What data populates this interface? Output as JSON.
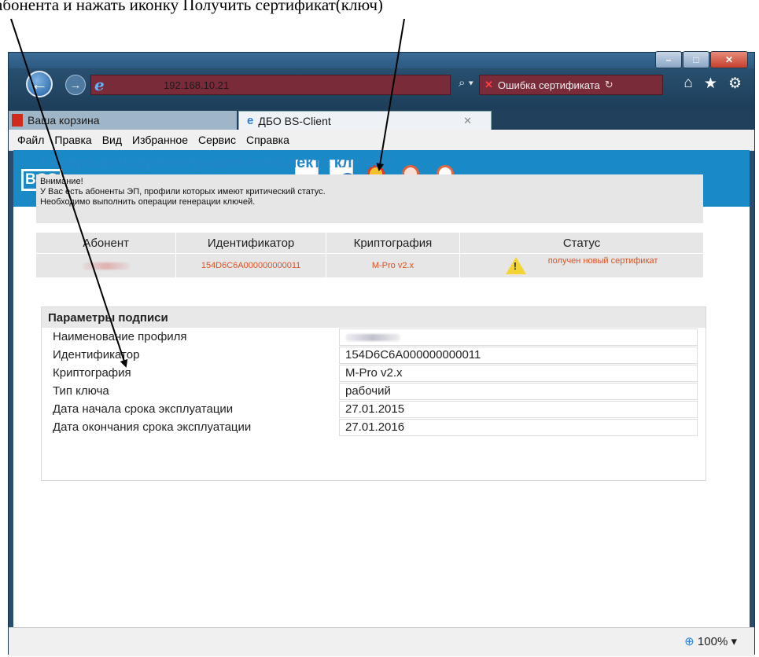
{
  "caption": "абонента и нажать иконку Получить сертификат(ключ)",
  "browser": {
    "url": "192.168.10.21",
    "search_glyph": "⌕ ▾",
    "cert_error": "Ошибка сертификата",
    "tabs": [
      {
        "label": "Ваша корзина"
      },
      {
        "label": "ДБО BS-Client",
        "close": "✕"
      }
    ],
    "menu": [
      "Файл",
      "Правка",
      "Вид",
      "Избранное",
      "Сервис",
      "Справка"
    ],
    "zoom": "100%"
  },
  "app": {
    "logo": "BSS",
    "page_title": "Генерация/перегенерация комплекта ключей",
    "alert_lines": [
      "Внимание!",
      "У Вас есть абоненты ЭП, профили которых имеют критический статус.",
      "Необходимо выполнить операции генерации ключей."
    ],
    "subscribers_table": {
      "headers": [
        "Абонент",
        "Идентификатор",
        "Криптография",
        "Статус"
      ],
      "row": {
        "identifier": "154D6C6A000000000011",
        "crypto": "M-Pro v2.x",
        "status": "получен новый сертификат"
      }
    },
    "params": {
      "title": "Параметры подписи",
      "rows": [
        {
          "label": "Наименование профиля",
          "value": ""
        },
        {
          "label": "Идентификатор",
          "value": "154D6C6A000000000011"
        },
        {
          "label": "Криптография",
          "value": "M-Pro v2.x"
        },
        {
          "label": "Тип ключа",
          "value": "рабочий"
        },
        {
          "label": "Дата начала срока эксплуатации",
          "value": "27.01.2015"
        },
        {
          "label": "Дата окончания срока эксплуатации",
          "value": "27.01.2016"
        }
      ]
    }
  },
  "colors": {
    "banner": "#1a8ac7",
    "title": "#2287c8",
    "status_accent": "#e05020"
  }
}
